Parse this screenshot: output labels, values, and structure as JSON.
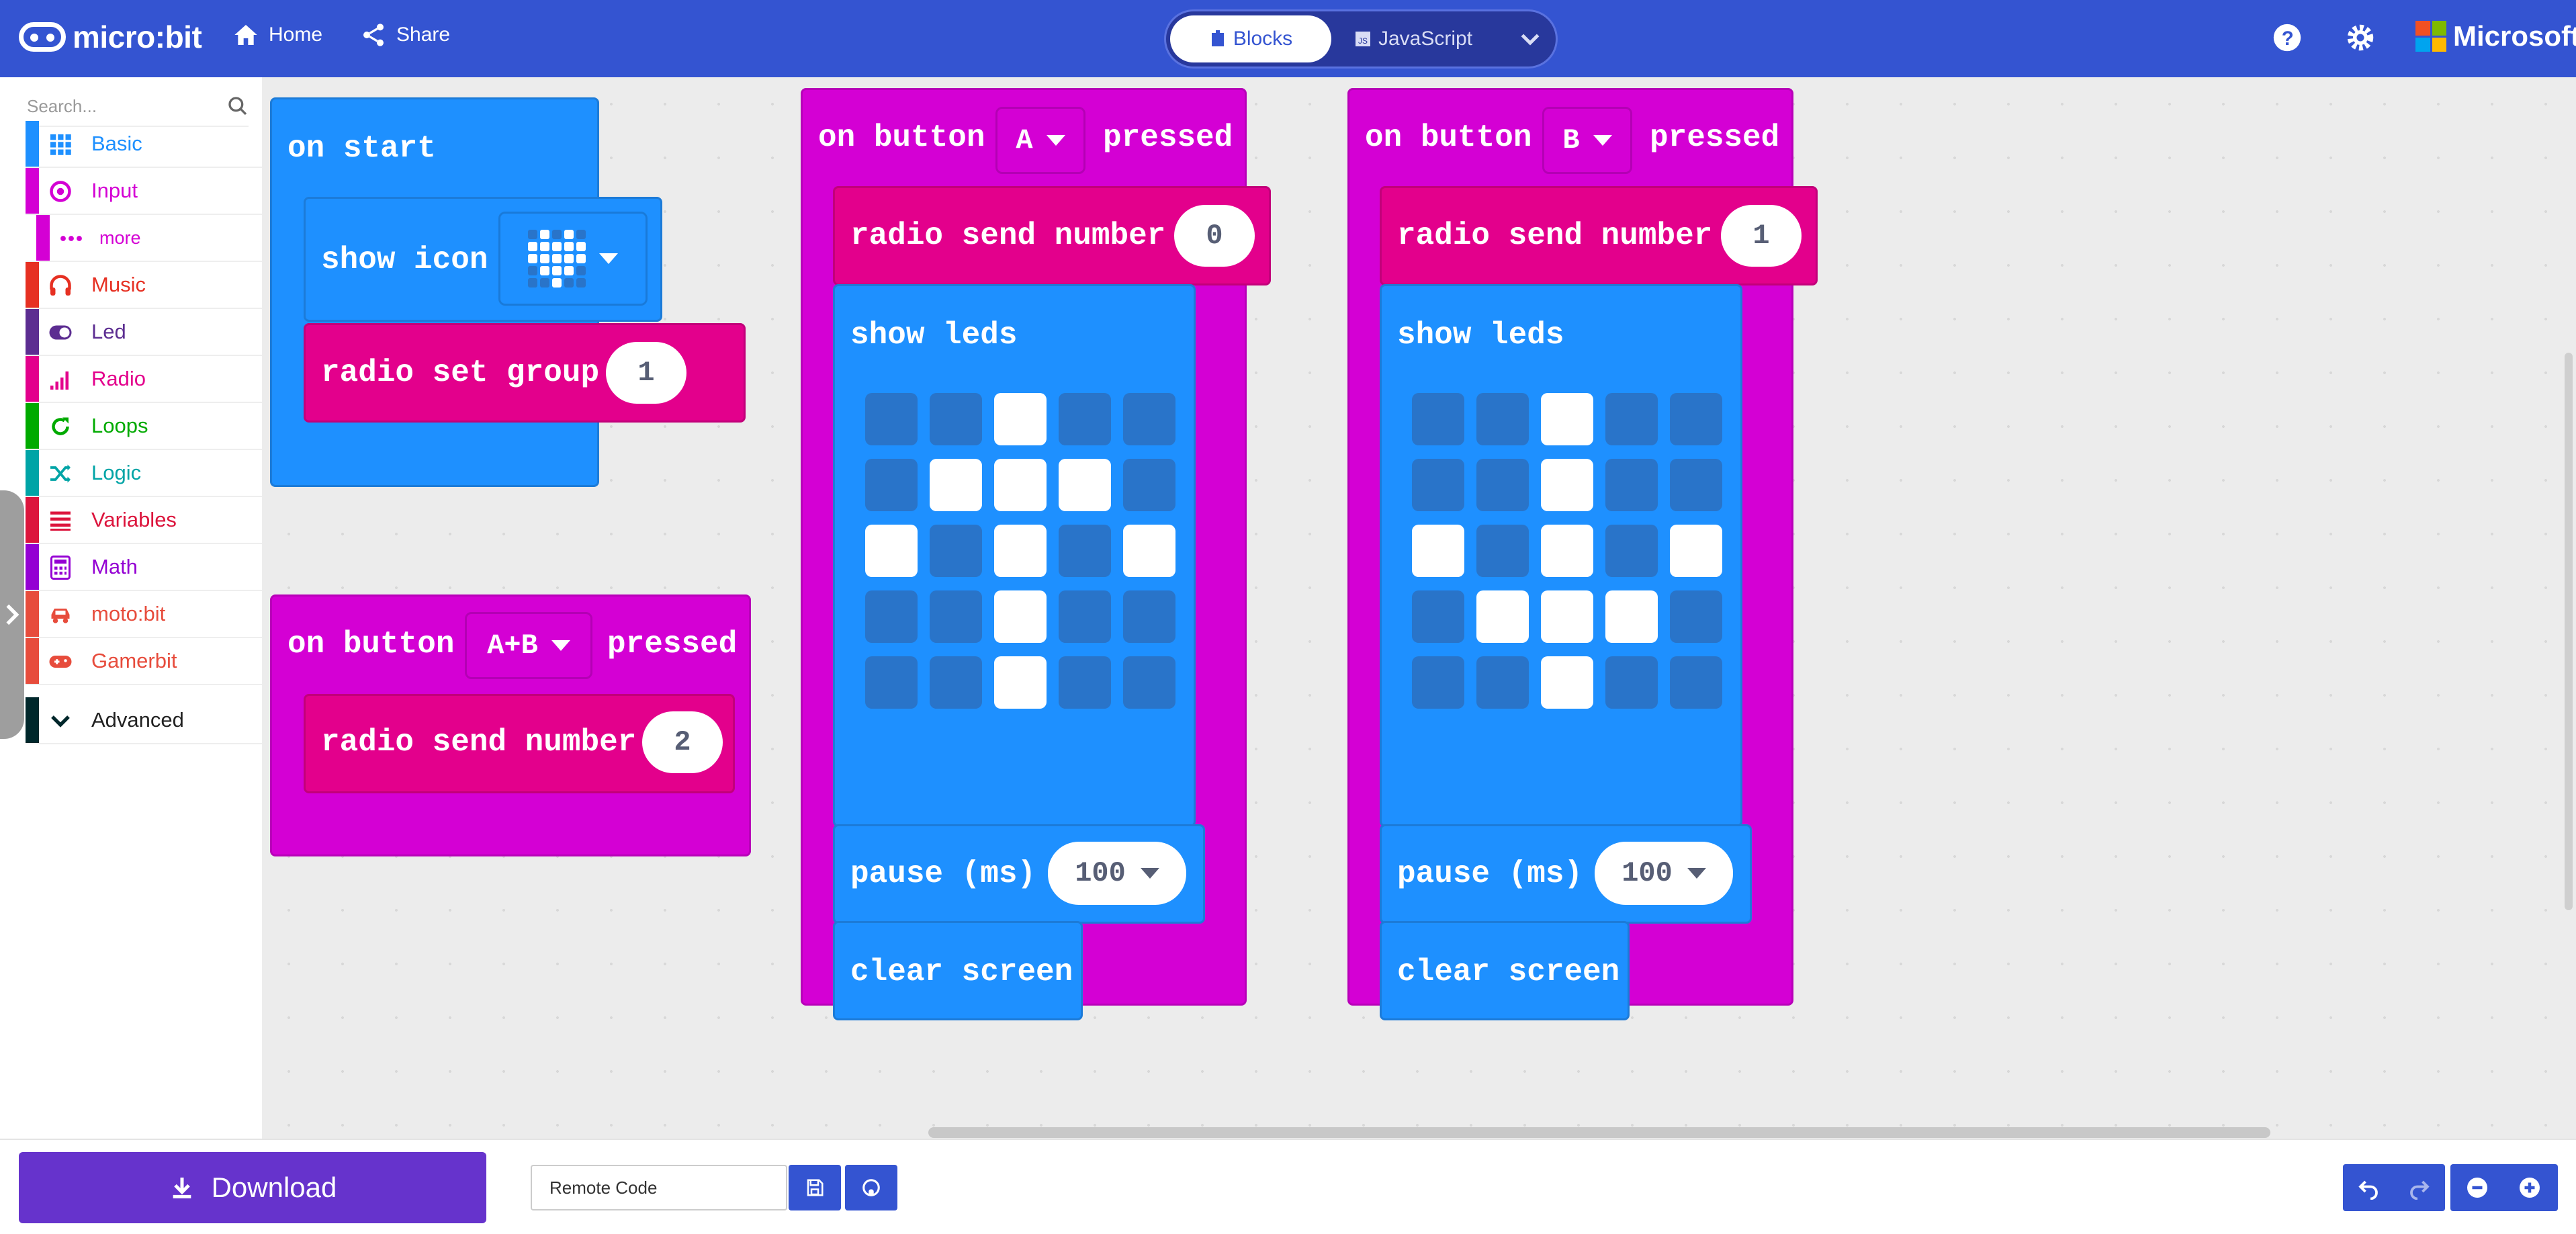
{
  "header": {
    "logo_text": "micro:bit",
    "home_label": "Home",
    "share_label": "Share",
    "blocks_label": "Blocks",
    "javascript_label": "JavaScript",
    "microsoft_label": "Microsoft",
    "brand_color": "#3454d1"
  },
  "sidebar": {
    "search_placeholder": "Search...",
    "categories": [
      {
        "label": "Basic",
        "color": "#1e90ff",
        "icon": "grid-icon"
      },
      {
        "label": "Input",
        "color": "#d400d4",
        "icon": "target-icon"
      },
      {
        "label": "more",
        "color": "#d400d4",
        "icon": "more-icon"
      },
      {
        "label": "Music",
        "color": "#e63022",
        "icon": "headphones-icon"
      },
      {
        "label": "Led",
        "color": "#5c2d91",
        "icon": "toggle-icon"
      },
      {
        "label": "Radio",
        "color": "#e3008c",
        "icon": "signal-icon"
      },
      {
        "label": "Loops",
        "color": "#00aa00",
        "icon": "loop-icon"
      },
      {
        "label": "Logic",
        "color": "#00a4a6",
        "icon": "shuffle-icon"
      },
      {
        "label": "Variables",
        "color": "#dc143c",
        "icon": "list-icon"
      },
      {
        "label": "Math",
        "color": "#9400d3",
        "icon": "calculator-icon"
      },
      {
        "label": "moto:bit",
        "color": "#e74c3c",
        "icon": "car-icon"
      },
      {
        "label": "Gamerbit",
        "color": "#e74c3c",
        "icon": "gamepad-icon"
      },
      {
        "label": "Advanced",
        "color": "#00272b",
        "icon": "chevron-down-icon"
      }
    ]
  },
  "blocks": {
    "on_start": "on start",
    "show_icon": "show icon",
    "radio_set_group": "radio set group",
    "radio_set_group_value": "1",
    "on_button": "on button",
    "pressed": "pressed",
    "button_ab": "A+B",
    "button_a": "A",
    "button_b": "B",
    "radio_send_number": "radio send number",
    "send_ab_value": "2",
    "send_a_value": "0",
    "send_b_value": "1",
    "show_leds": "show leds",
    "pause_ms": "pause (ms)",
    "pause_value": "100",
    "clear_screen": "clear screen",
    "leds_a": [
      [
        0,
        0,
        1,
        0,
        0
      ],
      [
        0,
        1,
        1,
        1,
        0
      ],
      [
        1,
        0,
        1,
        0,
        1
      ],
      [
        0,
        0,
        1,
        0,
        0
      ],
      [
        0,
        0,
        1,
        0,
        0
      ]
    ],
    "leds_b": [
      [
        0,
        0,
        1,
        0,
        0
      ],
      [
        0,
        0,
        1,
        0,
        0
      ],
      [
        1,
        0,
        1,
        0,
        1
      ],
      [
        0,
        1,
        1,
        1,
        0
      ],
      [
        0,
        0,
        1,
        0,
        0
      ]
    ],
    "icon_heart": [
      [
        0,
        1,
        0,
        1,
        0
      ],
      [
        1,
        1,
        1,
        1,
        1
      ],
      [
        1,
        1,
        1,
        1,
        1
      ],
      [
        0,
        1,
        1,
        1,
        0
      ],
      [
        0,
        0,
        1,
        0,
        0
      ]
    ]
  },
  "footer": {
    "download_label": "Download",
    "project_name": "Remote Code"
  }
}
